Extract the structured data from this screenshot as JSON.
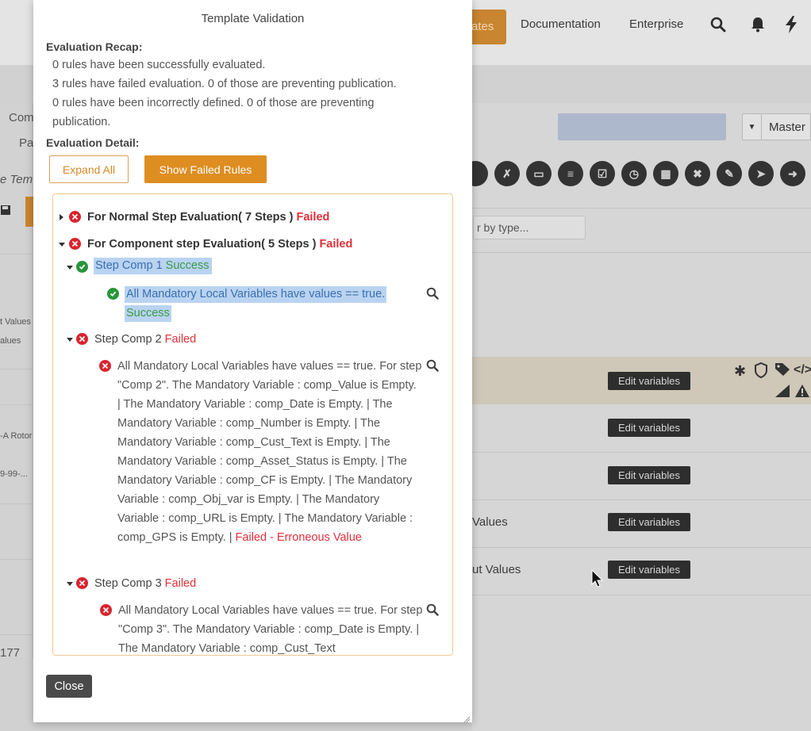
{
  "background": {
    "nav": {
      "active_fragment": "ates",
      "documentation": "Documentation",
      "enterprise": "Enterprise"
    },
    "left_column": {
      "com": "Com",
      "pa": "Pa",
      "e_tem": "e Tem",
      "values_1": "t Values",
      "values_2": "alues",
      "rotor": "-A Rotor",
      "code": "9-99-...",
      "num": "177"
    },
    "master_select": "Master",
    "filter_placeholder": "r by type...",
    "edit_variables_label": "Edit variables",
    "row_texts": {
      "values": "Values",
      "out_values": "ut Values"
    }
  },
  "modal": {
    "title": "Template Validation",
    "recap_title": "Evaluation Recap:",
    "recap_lines": [
      "0 rules have been successfully evaluated.",
      "3 rules have failed evaluation. 0 of those are preventing publication.",
      "0 rules have been incorrectly defined. 0 of those are preventing publication."
    ],
    "detail_title": "Evaluation Detail:",
    "expand_all": "Expand All",
    "show_failed": "Show Failed Rules",
    "tree": {
      "normal_step": {
        "label": "For Normal Step Evaluation( 7 Steps )",
        "status": "Failed"
      },
      "component_step": {
        "label": "For Component step Evaluation( 5 Steps )",
        "status": "Failed"
      },
      "step1": {
        "label": "Step Comp 1",
        "status": "Success"
      },
      "step1_rule": {
        "text": "All Mandatory Local Variables have values == true.",
        "status": "Success"
      },
      "step2": {
        "label": "Step Comp 2",
        "status": "Failed"
      },
      "step2_rule": {
        "text": "All Mandatory Local Variables have values == true. For step \"Comp 2\". The Mandatory Variable : comp_Value is Empty. | The Mandatory Variable : comp_Date is Empty. | The Mandatory Variable : comp_Number is Empty. | The Mandatory Variable : comp_Cust_Text is Empty. | The Mandatory Variable : comp_Asset_Status is Empty. | The Mandatory Variable : comp_CF is Empty. | The Mandatory Variable : comp_Obj_var is Empty. | The Mandatory Variable : comp_URL is Empty. | The Mandatory Variable : comp_GPS is Empty. |",
        "status": "Failed - Erroneous Value"
      },
      "step3": {
        "label": "Step Comp 3",
        "status": "Failed"
      },
      "step3_rule": {
        "text": "All Mandatory Local Variables have values == true. For step \"Comp 3\". The Mandatory Variable : comp_Date is Empty. | The Mandatory Variable : comp_Cust_Text"
      }
    },
    "close": "Close"
  }
}
